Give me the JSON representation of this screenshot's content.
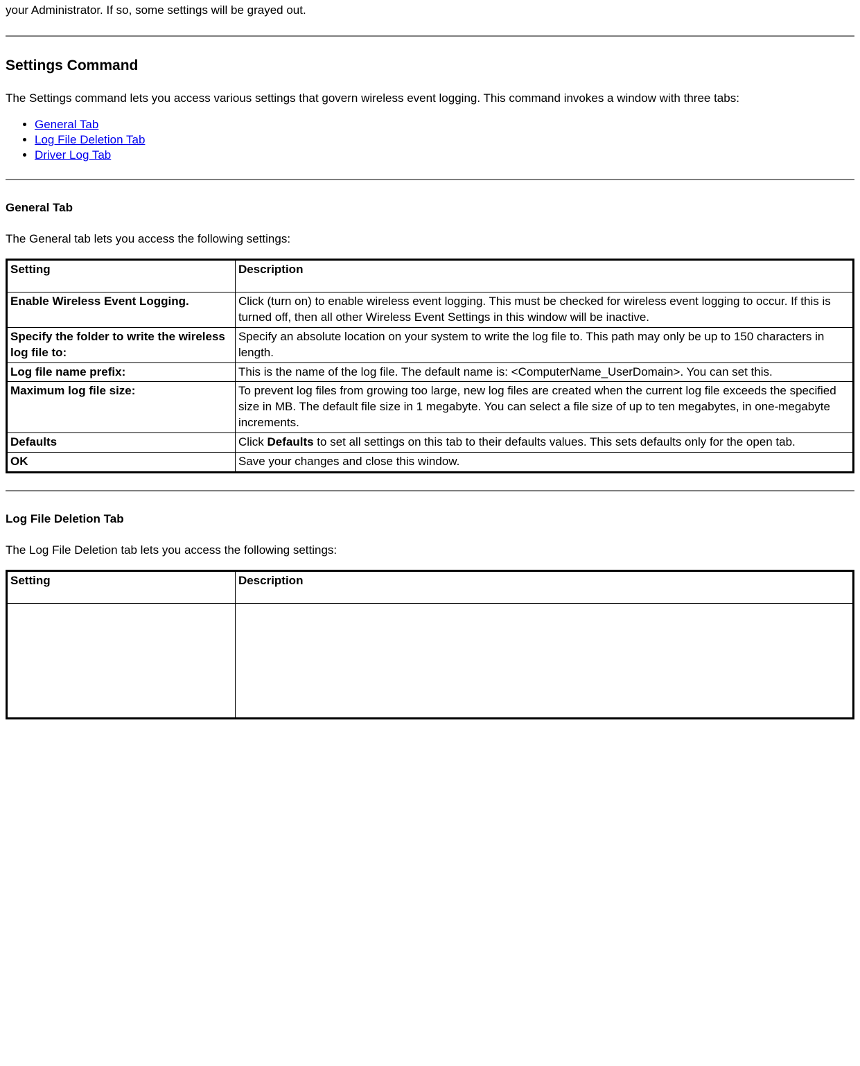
{
  "intro_fragment": "your Administrator. If so, some settings will be grayed out.",
  "settings_command": {
    "heading": "Settings Command",
    "paragraph": "The Settings command lets you access various settings that govern wireless event logging. This command invokes a window with three tabs:",
    "links": [
      "General Tab ",
      "Log File Deletion Tab",
      "Driver Log Tab"
    ]
  },
  "general_tab": {
    "heading": "General Tab",
    "paragraph": "The General tab lets you access the following settings:",
    "th_setting": "Setting",
    "th_description": "Description",
    "rows": [
      {
        "setting": "Enable Wireless Event Logging.",
        "description": "Click (turn on) to enable wireless event logging. This must be checked for wireless event logging to occur. If this is turned off, then all other Wireless Event Settings in this window will be inactive."
      },
      {
        "setting": "Specify the folder to write the wireless log file to:",
        "description": "Specify an absolute location on your system to write the log file to. This path may only be up to 150 characters in length."
      },
      {
        "setting": "Log file name prefix:",
        "description": "This is the name of the log file. The default name is: <ComputerName_UserDomain>. You can set this."
      },
      {
        "setting": "Maximum log file size:",
        "description": "To prevent log files from growing too large, new log files are created when the current log file exceeds the specified size in MB. The default file size in 1 megabyte. You can select a file size of up to ten megabytes, in one-megabyte increments."
      },
      {
        "setting": "Defaults",
        "description_prefix": "Click ",
        "description_bold": "Defaults",
        "description_suffix": " to set all settings on this tab to their defaults values. This sets defaults only for the open tab."
      },
      {
        "setting": "OK",
        "description": "Save your changes and close this window."
      }
    ]
  },
  "log_file_deletion_tab": {
    "heading": "Log File Deletion Tab",
    "paragraph": "The Log File Deletion tab lets you access the following settings:",
    "th_setting": "Setting",
    "th_description": "Description"
  }
}
